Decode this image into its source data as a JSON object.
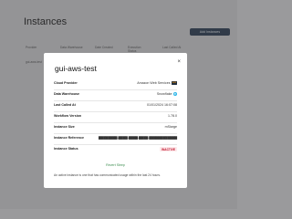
{
  "background": {
    "title": "Instances",
    "add_button": "Add Instances",
    "columns": [
      "Provider",
      "Data Warehouse",
      "Date Created",
      "Execution Status",
      "Last Called At"
    ],
    "row_name": "gui-aws-test"
  },
  "modal": {
    "title": "gui-aws-test",
    "close_glyph": "×",
    "rows": [
      {
        "label": "Cloud Provider",
        "value": "Amazon Web Services",
        "icon": "aws-icon",
        "icon_glyph": "aws"
      },
      {
        "label": "Data Warehouse",
        "value": "Snowflake",
        "icon": "snowflake-icon",
        "icon_glyph": "❄"
      },
      {
        "label": "Last Called At",
        "value": "01/01/2024 16:07:08"
      },
      {
        "label": "Workflow Version",
        "value": "1.78.0"
      },
      {
        "label": "Instance Size",
        "value": "mSlarge"
      },
      {
        "label": "Instance Reference",
        "value": "▇▇▇▇▇▇▇▇-▇▇▇▇-▇▇▇▇-▇▇▇▇-▇▇▇▇▇▇▇▇▇▇▇▇"
      },
      {
        "label": "Instance Status",
        "value": "INACTIVE"
      }
    ],
    "note": "An active instance is one that has communicated usage within the last 24 hours.",
    "revert_label": "Revert Sleep",
    "colors": {
      "badge_bg": "#fde8ea",
      "badge_fg": "#c0162e",
      "link": "#3c8d4f",
      "button": "#2a3c52"
    }
  }
}
